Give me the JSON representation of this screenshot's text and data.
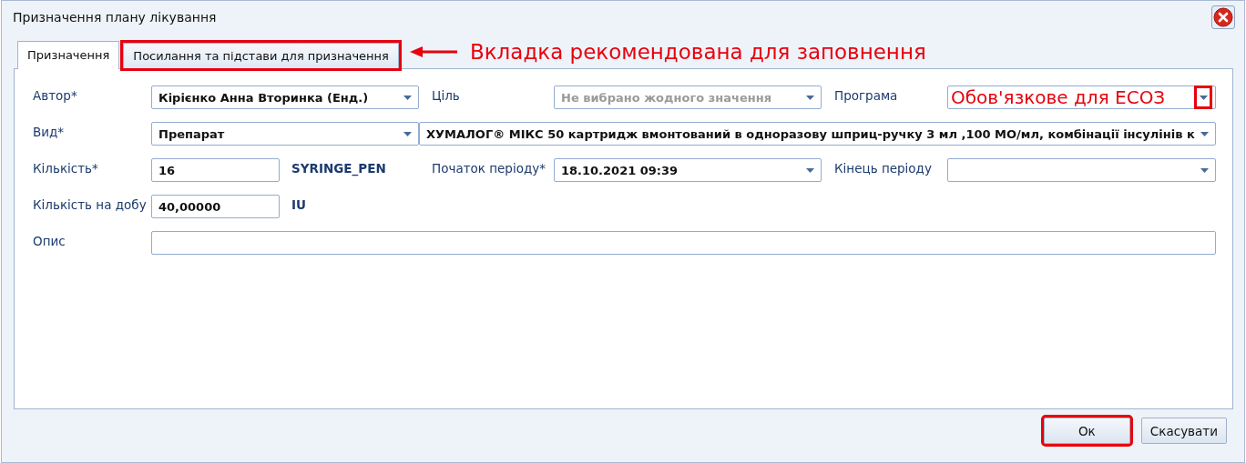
{
  "window": {
    "title": "Призначення плану лікування"
  },
  "tabs": [
    {
      "label": "Призначення",
      "selected": true,
      "highlighted": false
    },
    {
      "label": "Посилання та підстави для призначення",
      "selected": false,
      "highlighted": true
    }
  ],
  "tab_callout": "Вкладка рекомендована для заповнення",
  "rows": [
    [
      {
        "label": "Автор*",
        "kind": "combo",
        "value": "Кірієнко Анна Вторинка (Енд.)"
      },
      {
        "label": "Ціль",
        "kind": "combo",
        "placeholder": "Не вибрано жодного значення"
      },
      {
        "label": "Програма",
        "kind": "combo",
        "highlighted": true,
        "callout": "Обов'язкове для ЕСОЗ"
      }
    ],
    [
      {
        "label": "Вид*",
        "kind": "combo",
        "value": "Препарат"
      },
      {
        "kind": "combo",
        "value": "ХУМАЛОГ® МІКС 50 картридж вмонтований в одноразову шприц-ручку 3 мл ,100 МО/мл, комбінації інсулінів к"
      }
    ],
    [
      {
        "label": "Кількість*",
        "kind": "text",
        "value": "16",
        "unit": "SYRINGE_PEN"
      },
      {
        "label": "Початок періоду*",
        "kind": "combo",
        "value": "18.10.2021 09:39"
      },
      {
        "label": "Кінець періоду",
        "kind": "combo"
      }
    ],
    [
      {
        "label": "Кількість на добу",
        "kind": "text",
        "value": "40,00000",
        "unit": "IU"
      }
    ],
    [
      {
        "label": "Опис",
        "kind": "text"
      }
    ]
  ],
  "buttons": [
    {
      "label": "Ок",
      "highlighted": true
    },
    {
      "label": "Скасувати",
      "highlighted": false
    }
  ]
}
